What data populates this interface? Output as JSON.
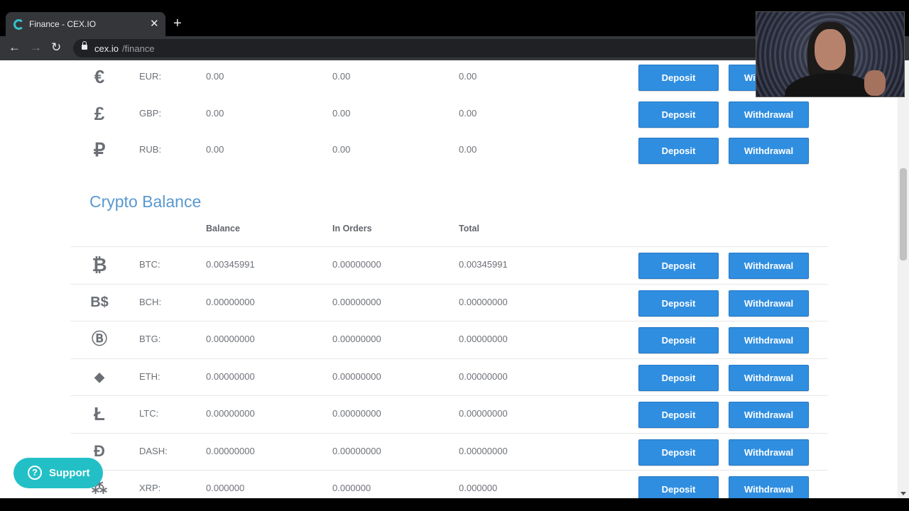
{
  "browser": {
    "tab_title": "Finance - CEX.IO",
    "tab_close": "✕",
    "new_tab": "+",
    "back": "←",
    "forward": "→",
    "reload": "↻",
    "url_host": "cex.io",
    "url_path": "/finance"
  },
  "fiat_rows": [
    {
      "icon": "euro-icon",
      "symbol": "€",
      "code": "EUR:",
      "balance": "0.00",
      "in_orders": "0.00",
      "total": "0.00",
      "deposit": "Deposit",
      "withdrawal": "Withdrawal"
    },
    {
      "icon": "pound-icon",
      "symbol": "£",
      "code": "GBP:",
      "balance": "0.00",
      "in_orders": "0.00",
      "total": "0.00",
      "deposit": "Deposit",
      "withdrawal": "Withdrawal"
    },
    {
      "icon": "ruble-icon",
      "symbol": "₽",
      "code": "RUB:",
      "balance": "0.00",
      "in_orders": "0.00",
      "total": "0.00",
      "deposit": "Deposit",
      "withdrawal": "Withdrawal"
    }
  ],
  "crypto": {
    "title": "Crypto Balance",
    "headers": {
      "balance": "Balance",
      "in_orders": "In Orders",
      "total": "Total"
    },
    "rows": [
      {
        "icon": "bitcoin-icon",
        "symbol": "₿",
        "code": "BTC:",
        "balance": "0.00345991",
        "in_orders": "0.00000000",
        "total": "0.00345991",
        "deposit": "Deposit",
        "withdrawal": "Withdrawal"
      },
      {
        "icon": "bitcoin-cash-icon",
        "symbol": "B$",
        "code": "BCH:",
        "balance": "0.00000000",
        "in_orders": "0.00000000",
        "total": "0.00000000",
        "deposit": "Deposit",
        "withdrawal": "Withdrawal"
      },
      {
        "icon": "bitcoin-gold-icon",
        "symbol": "Ⓑ",
        "code": "BTG:",
        "balance": "0.00000000",
        "in_orders": "0.00000000",
        "total": "0.00000000",
        "deposit": "Deposit",
        "withdrawal": "Withdrawal"
      },
      {
        "icon": "ethereum-icon",
        "symbol": "◆",
        "code": "ETH:",
        "balance": "0.00000000",
        "in_orders": "0.00000000",
        "total": "0.00000000",
        "deposit": "Deposit",
        "withdrawal": "Withdrawal"
      },
      {
        "icon": "litecoin-icon",
        "symbol": "Ł",
        "code": "LTC:",
        "balance": "0.00000000",
        "in_orders": "0.00000000",
        "total": "0.00000000",
        "deposit": "Deposit",
        "withdrawal": "Withdrawal"
      },
      {
        "icon": "dash-icon",
        "symbol": "Đ",
        "code": "DASH:",
        "balance": "0.00000000",
        "in_orders": "0.00000000",
        "total": "0.00000000",
        "deposit": "Deposit",
        "withdrawal": "Withdrawal"
      },
      {
        "icon": "ripple-icon",
        "symbol": "⁂",
        "code": "XRP:",
        "balance": "0.000000",
        "in_orders": "0.000000",
        "total": "0.000000",
        "deposit": "Deposit",
        "withdrawal": "Withdrawal"
      }
    ]
  },
  "support": {
    "icon": "?",
    "label": "Support"
  },
  "colors": {
    "accent_blue": "#2f8ee0",
    "section_title": "#5a98cf",
    "support_teal": "#22c0c6"
  }
}
